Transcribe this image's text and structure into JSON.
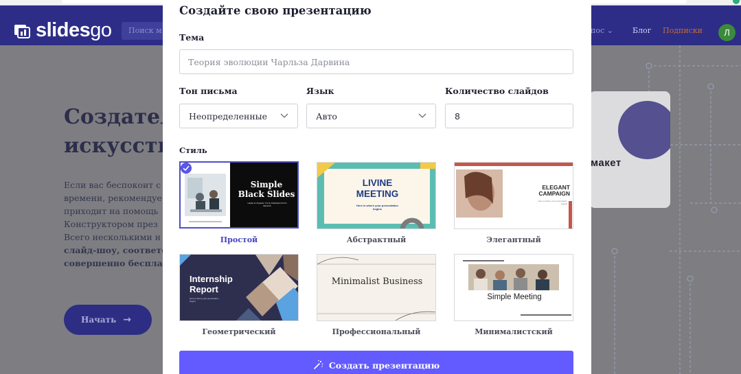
{
  "background": {
    "logo": {
      "brand": "slides",
      "brand_suffix": "go"
    },
    "search_placeholder": "Поиск м",
    "nav": {
      "dropdown": "пос ⌄",
      "blog": "Блог",
      "subscriptions": "Подписки"
    },
    "avatar_initial": "Л",
    "hero": {
      "title_line1": "Создатель",
      "title_line2": "искусстве",
      "paragraph_lines": [
        "Если вас беспокоит с",
        "времени, рекомендуе",
        "приходит на помощь",
        "Конструктором през",
        "Всего несколькими н"
      ],
      "paragraph_bold_lines": [
        "слайд-шоу, соответс",
        "совершенно беспла"
      ],
      "start_button": "Начать"
    },
    "card_word": "макет"
  },
  "modal": {
    "title": "Создайте свою презентацию",
    "topic": {
      "label": "Тема",
      "placeholder": "Теория эволюции Чарльза Дарвина",
      "value": ""
    },
    "tone": {
      "label": "Тон письма",
      "value": "Неопределенные"
    },
    "language": {
      "label": "Язык",
      "value": "Авто"
    },
    "slides_count": {
      "label": "Количество слайдов",
      "value": "8"
    },
    "style_label": "Стиль",
    "styles": [
      {
        "caption": "Простой",
        "thumb_title": "Simple Black Slides",
        "thumb_subtitle": "HERE IS WHERE YOUR PRESENTATION BEGINS",
        "selected": true
      },
      {
        "caption": "Абстрактный",
        "thumb_title": "LIVINE MEETING",
        "thumb_subtitle": "Here is where your presentation begins",
        "selected": false
      },
      {
        "caption": "Элегантный",
        "thumb_title": "ELEGANT CAMPAIGN",
        "thumb_subtitle": "Here is where your presentation begins",
        "selected": false
      },
      {
        "caption": "Геометрический",
        "thumb_title": "Internship Report",
        "thumb_subtitle": "Here is where your presentation begins",
        "selected": false
      },
      {
        "caption": "Профессиональный",
        "thumb_title": "Minimalist Business",
        "thumb_subtitle": "",
        "selected": false
      },
      {
        "caption": "Минималистский",
        "thumb_title": "Simple Meeting",
        "thumb_subtitle": "",
        "selected": false
      }
    ],
    "create_button": "Создать презентацию"
  },
  "colors": {
    "accent": "#635bff",
    "header_bg": "#2d2d88",
    "selected_border": "#4d4dc9",
    "overlay_bg": "#7e7e82"
  },
  "icons": [
    "logo-icon",
    "chevron-down-icon",
    "check-icon",
    "magic-wand-icon",
    "arrow-right-icon"
  ]
}
